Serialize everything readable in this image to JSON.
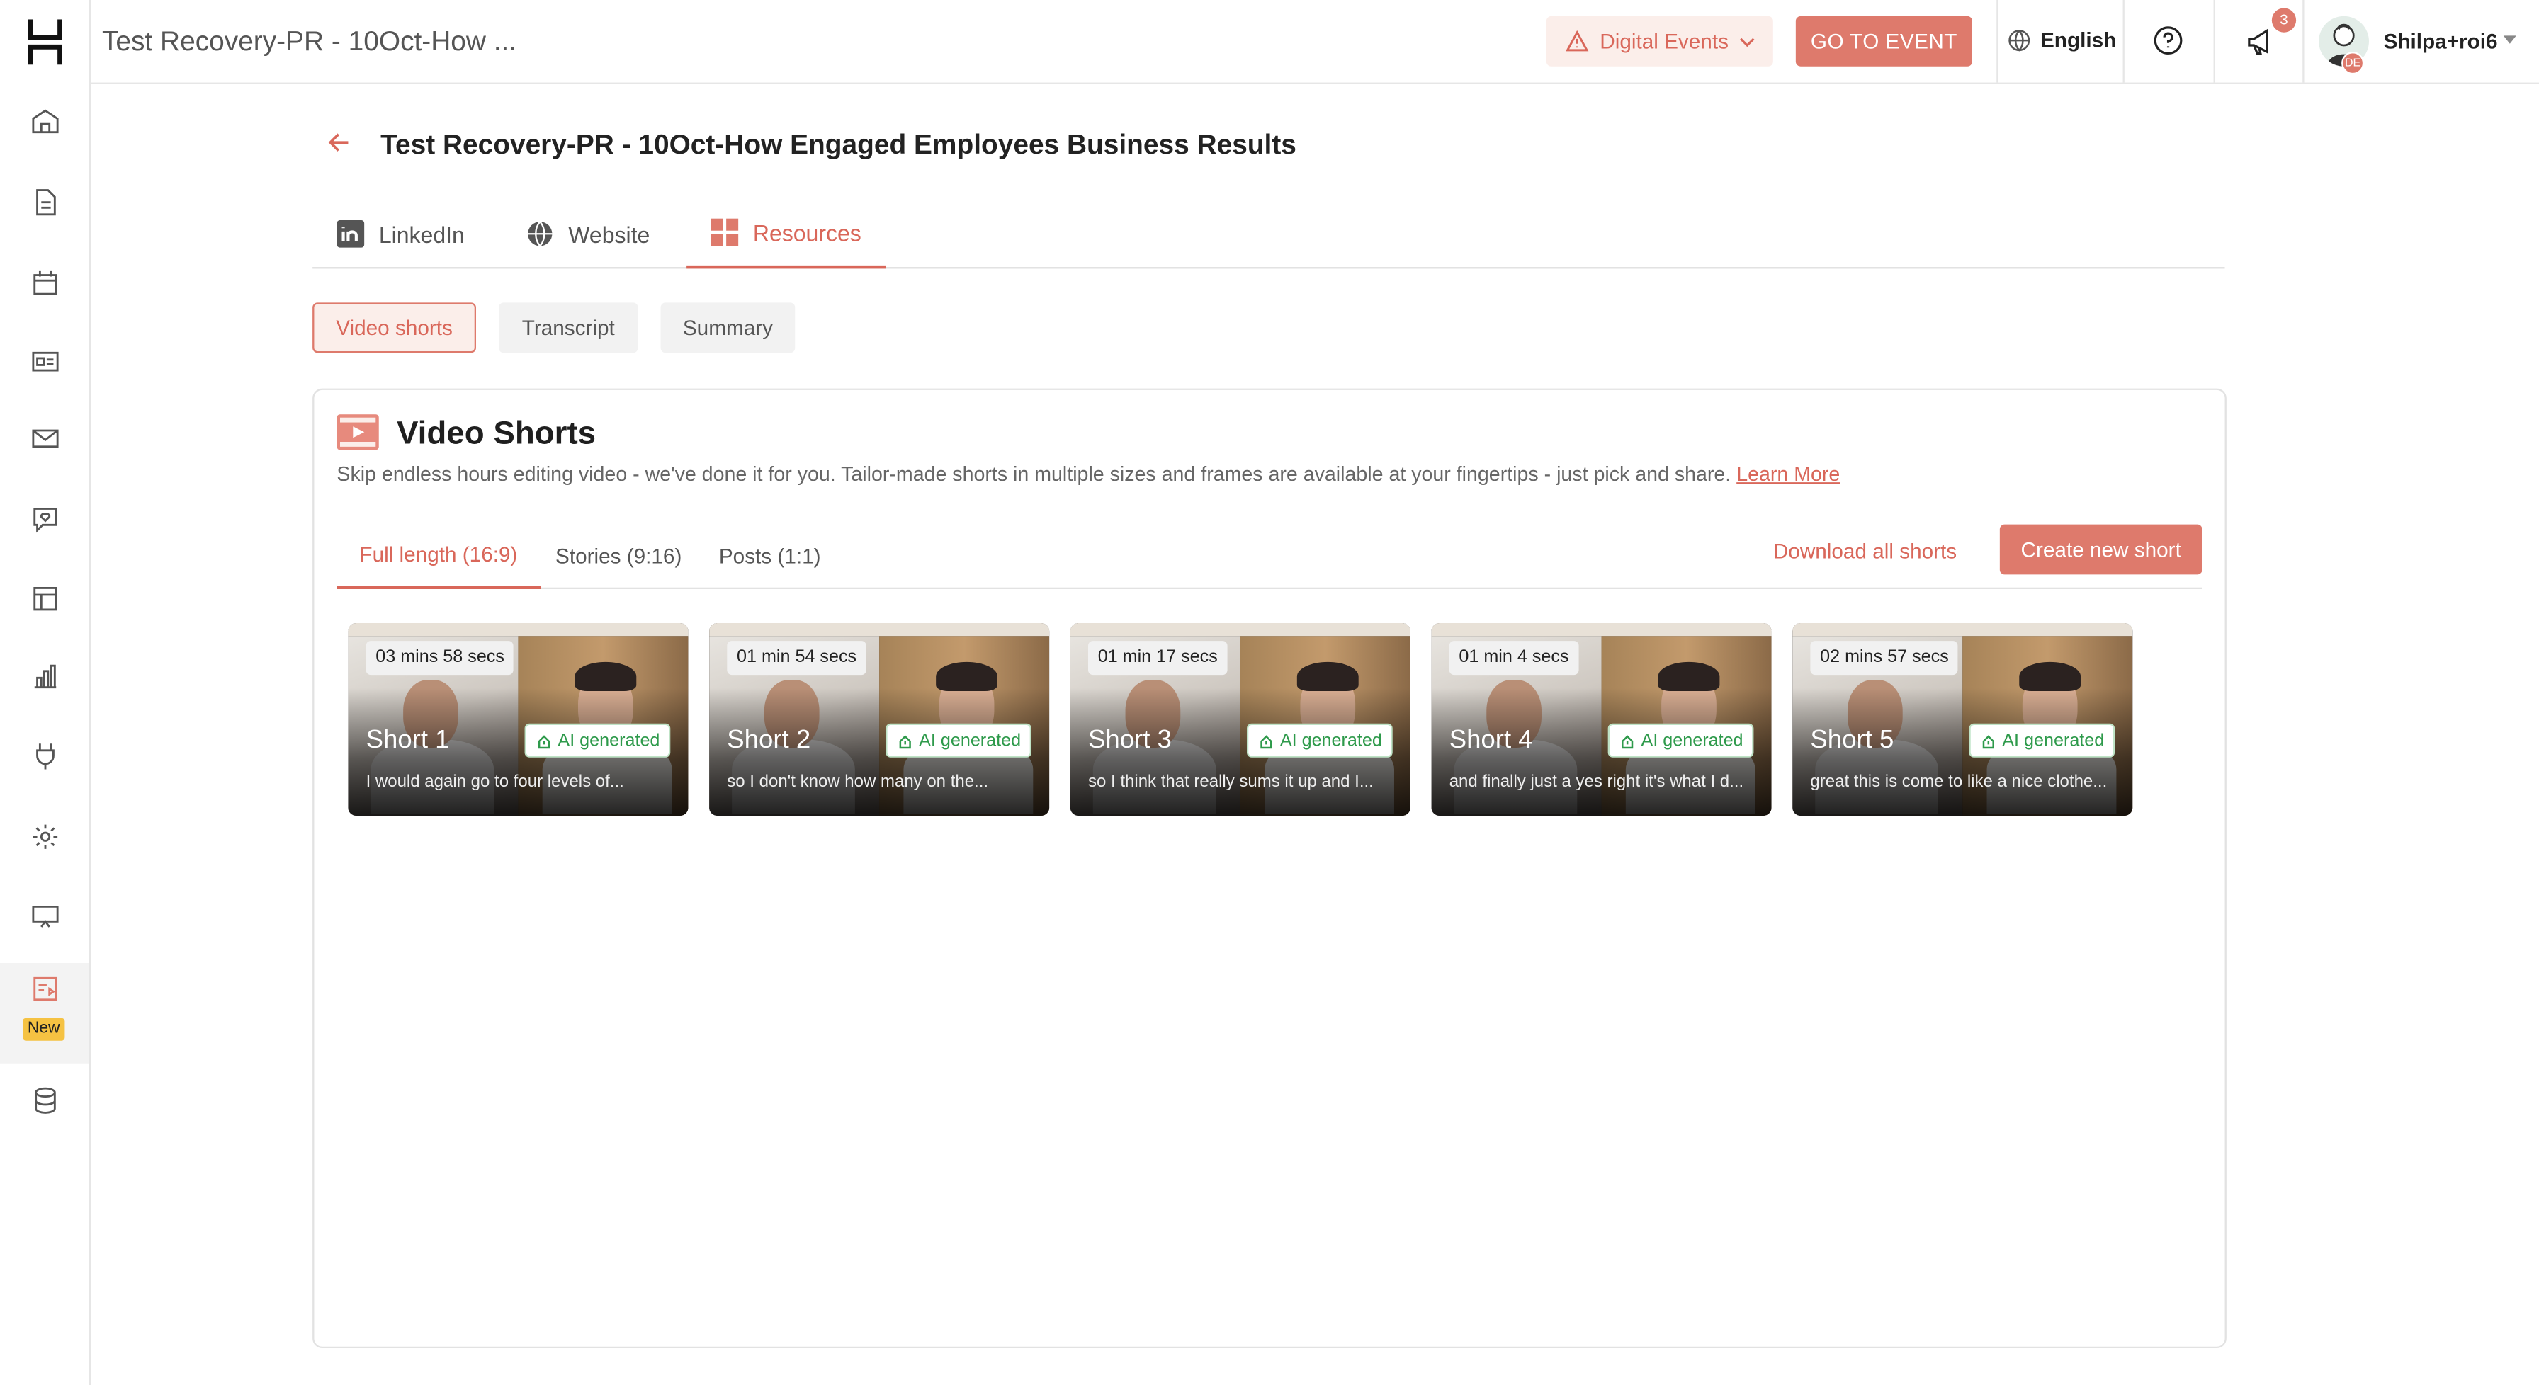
{
  "app": {
    "window_title": "Test Recovery-PR - 10Oct-How ...",
    "event_selector": "Digital Events",
    "go_to_event": "GO TO EVENT",
    "language": "English",
    "notification_count": "3",
    "user_name": "Shilpa+roi6",
    "avatar_flag": "DE"
  },
  "sidebar": {
    "new_badge": "New",
    "items": [
      "home-icon",
      "document-icon",
      "calendar-icon",
      "badge-icon",
      "mail-icon",
      "chat-heart-icon",
      "layout-icon",
      "bar-chart-icon",
      "plug-icon",
      "settings-icon",
      "monitor-icon",
      "video-shorts-icon",
      "database-icon"
    ]
  },
  "page": {
    "title": "Test Recovery-PR - 10Oct-How Engaged Employees Business Results",
    "tabs": [
      "LinkedIn",
      "Website",
      "Resources"
    ],
    "active_tab": "Resources",
    "subtabs": [
      "Video shorts",
      "Transcript",
      "Summary"
    ],
    "active_subtab": "Video shorts"
  },
  "card": {
    "title": "Video Shorts",
    "description": "Skip endless hours editing video - we've done it for you. Tailor-made shorts in multiple sizes and frames are available at your fingertips - just pick and share.",
    "learn_more": "Learn More",
    "format_tabs": [
      "Full length (16:9)",
      "Stories (9:16)",
      "Posts (1:1)"
    ],
    "active_format": "Full length (16:9)",
    "download_all": "Download all shorts",
    "create_new": "Create new short"
  },
  "shorts": [
    {
      "name": "Short 1",
      "duration": "03 mins 58 secs",
      "badge": "AI generated",
      "caption": "I would again go to four levels of..."
    },
    {
      "name": "Short 2",
      "duration": "01 min 54 secs",
      "badge": "AI generated",
      "caption": "so I don't know how many on the..."
    },
    {
      "name": "Short 3",
      "duration": "01 min 17 secs",
      "badge": "AI generated",
      "caption": "so I think that really sums it up and I..."
    },
    {
      "name": "Short 4",
      "duration": "01 min 4 secs",
      "badge": "AI generated",
      "caption": "and finally just a yes right it's what I d..."
    },
    {
      "name": "Short 5",
      "duration": "02 mins 57 secs",
      "badge": "AI generated",
      "caption": "great this is come to like a nice clothe..."
    }
  ],
  "colors": {
    "accent": "#de7a6c",
    "accent_text": "#d9675a",
    "ai_green": "#2e9a4b"
  }
}
